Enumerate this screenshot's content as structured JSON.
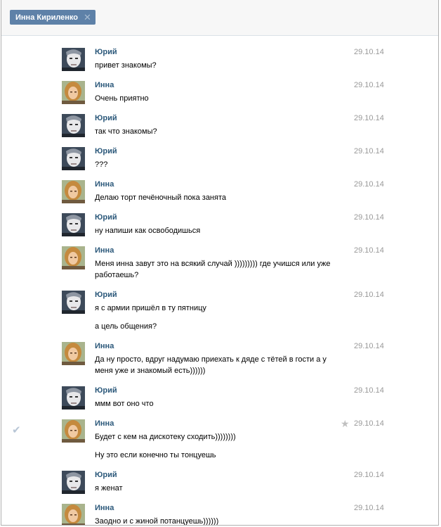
{
  "tab": {
    "title": "Инна Кириленко",
    "close_icon": "close-icon"
  },
  "messages": [
    {
      "author": "Юрий",
      "date": "29.10.14",
      "avatar": "yuri",
      "lines": [
        "привет знакомы?"
      ]
    },
    {
      "author": "Инна",
      "date": "29.10.14",
      "avatar": "inna",
      "lines": [
        "Очень приятно"
      ]
    },
    {
      "author": "Юрий",
      "date": "29.10.14",
      "avatar": "yuri",
      "lines": [
        "так что знакомы?"
      ]
    },
    {
      "author": "Юрий",
      "date": "29.10.14",
      "avatar": "yuri",
      "lines": [
        "???"
      ]
    },
    {
      "author": "Инна",
      "date": "29.10.14",
      "avatar": "inna",
      "lines": [
        "Делаю торт печёночный пока занята"
      ]
    },
    {
      "author": "Юрий",
      "date": "29.10.14",
      "avatar": "yuri",
      "lines": [
        "ну напиши как освободишься"
      ]
    },
    {
      "author": "Инна",
      "date": "29.10.14",
      "avatar": "inna",
      "lines": [
        "Меня инна завут это на всякий случай ))))))))) где учишся или уже",
        "работаешь?"
      ]
    },
    {
      "author": "Юрий",
      "date": "29.10.14",
      "avatar": "yuri",
      "lines": [
        "я с армии пришёл в ту пятницу"
      ],
      "extra": "а цель общения?"
    },
    {
      "author": "Инна",
      "date": "29.10.14",
      "avatar": "inna",
      "lines": [
        "Да ну просто, вдруг надумаю приехать к дяде с тётей в гости а у",
        "меня уже и знакомый есть))))))"
      ]
    },
    {
      "author": "Юрий",
      "date": "29.10.14",
      "avatar": "yuri",
      "lines": [
        "ммм вот оно что"
      ]
    },
    {
      "author": "Инна",
      "date": "29.10.14",
      "avatar": "inna",
      "lines": [
        "Будет с кем на дискотеку сходить))))))))"
      ],
      "extra": "Ну это если конечно ты тонцуешь",
      "checked": true,
      "starred": true
    },
    {
      "author": "Юрий",
      "date": "29.10.14",
      "avatar": "yuri",
      "lines": [
        "я женат"
      ]
    },
    {
      "author": "Инна",
      "date": "29.10.14",
      "avatar": "inna",
      "lines": [
        "Заодно и с жиной потанцуешь))))))"
      ]
    }
  ]
}
